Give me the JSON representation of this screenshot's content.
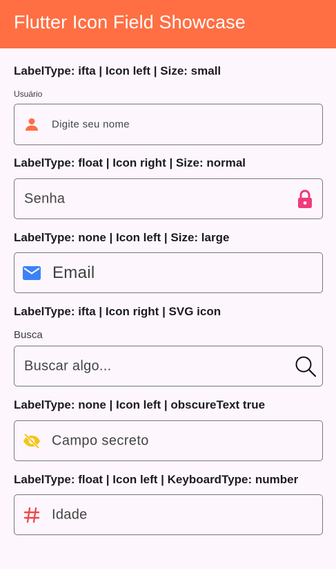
{
  "appbar": {
    "title": "Flutter Icon Field Showcase"
  },
  "sections": [
    {
      "title": "LabelType: ifta | Icon left | Size: small",
      "ifta_label": "Usuário",
      "placeholder": "Digite seu nome",
      "icon": "person-icon",
      "icon_color": "#ff6f43"
    },
    {
      "title": "LabelType: float | Icon right | Size: normal",
      "placeholder": "Senha",
      "icon": "lock-icon",
      "icon_color": "#f23a7a"
    },
    {
      "title": "LabelType: none | Icon left | Size: large",
      "placeholder": "Email",
      "icon": "email-icon",
      "icon_color": "#3b82f6"
    },
    {
      "title": "LabelType: ifta | Icon right | SVG icon",
      "ifta_label": "Busca",
      "placeholder": "Buscar algo...",
      "icon": "search-icon",
      "icon_color": "#111111"
    },
    {
      "title": "LabelType: none | Icon left | obscureText true",
      "placeholder": "Campo secreto",
      "icon": "visibility-off-icon",
      "icon_color": "#f5c518"
    },
    {
      "title": "LabelType: float | Icon left | KeyboardType: number",
      "placeholder": "Idade",
      "icon": "hashtag-icon",
      "icon_color": "#f04a4a"
    }
  ]
}
